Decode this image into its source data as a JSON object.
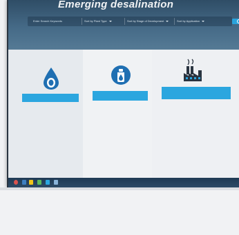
{
  "hero": {
    "title": "Emerging desalination"
  },
  "search": {
    "input_text": "Enter Search Keywords",
    "filters": [
      "Sort by Plant Type",
      "Sort by Stage of Development",
      "Sort by Application"
    ]
  },
  "cards": [
    {
      "icon": "water-drop-icon",
      "banner": "",
      "paragraphs": [
        "",
        ""
      ],
      "links": [
        "",
        "",
        ""
      ]
    },
    {
      "icon": "bottle-icon",
      "banner": "",
      "paragraphs": [
        "",
        ""
      ],
      "links": [
        ""
      ]
    },
    {
      "icon": "factory-icon",
      "banner": "",
      "lead": "",
      "paragraphs": [
        "",
        ""
      ],
      "links": [
        ""
      ]
    }
  ],
  "colors": {
    "accent": "#2ba6df",
    "hero": "#3f6380",
    "taskbar": "#1f3a54"
  }
}
